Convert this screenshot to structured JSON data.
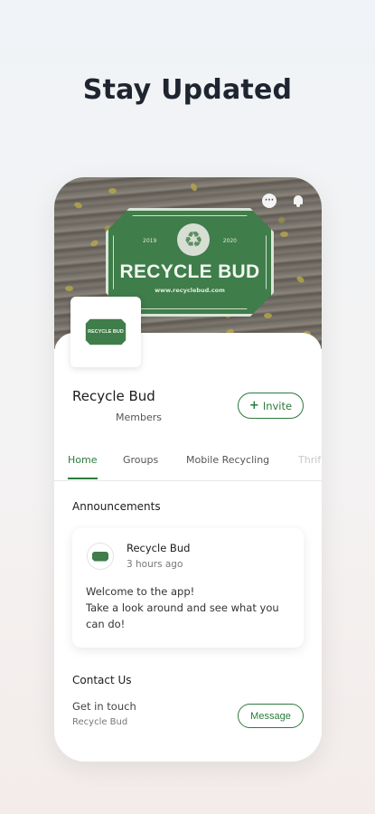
{
  "headline": "Stay Updated",
  "cover": {
    "sign_title": "RECYCLE BUD",
    "sign_url": "www.recyclebud.com",
    "sign_year_left": "2019",
    "sign_year_right": "2020",
    "icons": [
      "chat-icon",
      "bell-icon"
    ]
  },
  "group": {
    "logo_text": "RECYCLE BUD",
    "name": "Recycle Bud",
    "members_label": "Members",
    "invite_label": "Invite"
  },
  "tabs": [
    {
      "label": "Home",
      "active": true
    },
    {
      "label": "Groups",
      "active": false
    },
    {
      "label": "Mobile Recycling",
      "active": false
    },
    {
      "label": "Thrif",
      "active": false
    }
  ],
  "announcements": {
    "title": "Announcements",
    "post": {
      "author": "Recycle Bud",
      "time": "3 hours ago",
      "body": "Welcome to the app!\nTake a look around and see what you can do!"
    }
  },
  "contact": {
    "title": "Contact Us",
    "subtitle": "Get in touch",
    "name": "Recycle Bud",
    "message_label": "Message"
  },
  "colors": {
    "accent": "#2d7a3c",
    "sign_green": "#3f7d4a"
  }
}
